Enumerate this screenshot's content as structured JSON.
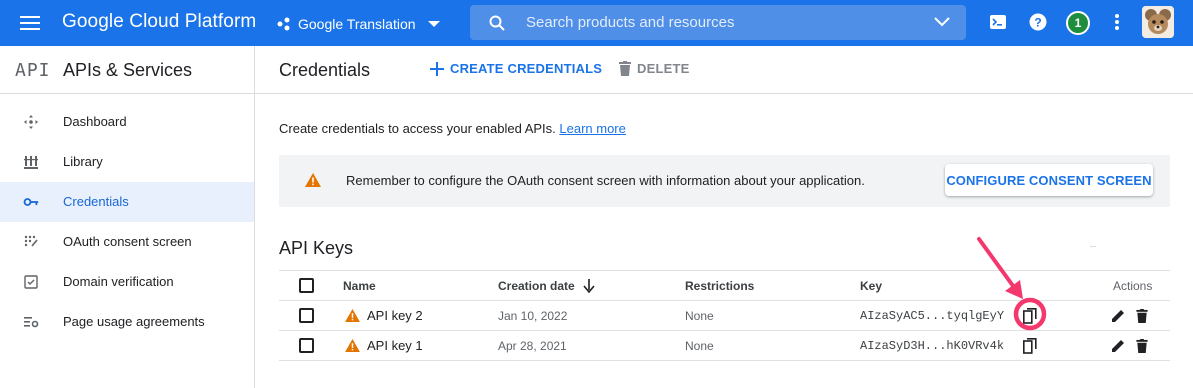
{
  "topbar": {
    "brand": "Google Cloud Platform",
    "project_name": "Google Translation",
    "search_placeholder": "Search products and resources",
    "notification_count": "1"
  },
  "sidebar": {
    "logo": "API",
    "title": "APIs & Services",
    "items": [
      {
        "label": "Dashboard",
        "icon": "dashboard-icon",
        "active": false
      },
      {
        "label": "Library",
        "icon": "library-icon",
        "active": false
      },
      {
        "label": "Credentials",
        "icon": "key-icon",
        "active": true
      },
      {
        "label": "OAuth consent screen",
        "icon": "oauth-icon",
        "active": false
      },
      {
        "label": "Domain verification",
        "icon": "domain-check-icon",
        "active": false
      },
      {
        "label": "Page usage agreements",
        "icon": "settings-list-icon",
        "active": false
      }
    ]
  },
  "main": {
    "title": "Credentials",
    "create_label": "CREATE CREDENTIALS",
    "delete_label": "DELETE",
    "intro_text": "Create credentials to access your enabled APIs.",
    "learn_more": "Learn more",
    "banner_text": "Remember to configure the OAuth consent screen with information about your application.",
    "consent_button": "CONFIGURE CONSENT SCREEN",
    "section_title": "API Keys",
    "table": {
      "columns": [
        "Name",
        "Creation date",
        "Restrictions",
        "Key",
        "Actions"
      ],
      "rows": [
        {
          "name": "API key 2",
          "date": "Jan 10, 2022",
          "restrictions": "None",
          "key": "AIzaSyAC5...tyqlgEyY"
        },
        {
          "name": "API key 1",
          "date": "Apr 28, 2021",
          "restrictions": "None",
          "key": "AIzaSyD3H...hK0VRv4k"
        }
      ]
    }
  },
  "colors": {
    "primary": "#1a73e8",
    "warning": "#e37400",
    "annotation": "#f4376d"
  }
}
